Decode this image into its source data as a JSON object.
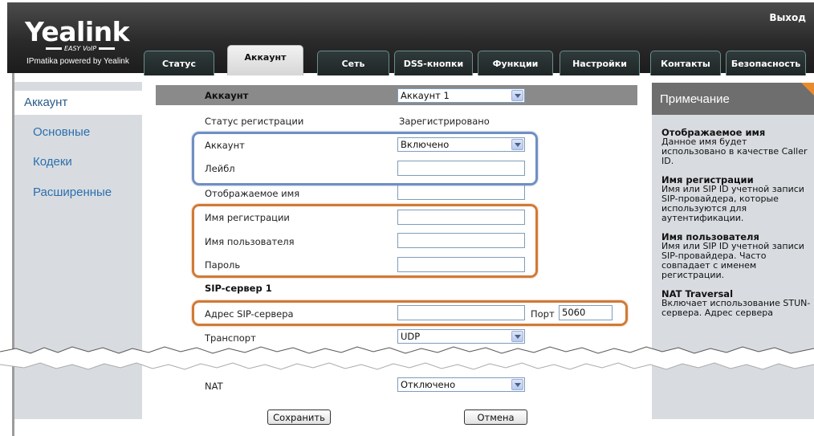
{
  "header": {
    "logo": "Yealink",
    "logo_sub": "EASY VoIP",
    "logo_tagline": "IPmatika powered by Yealink",
    "logout": "Выход",
    "tabs": [
      "Статус",
      "Аккаунт",
      "Сеть",
      "DSS-кнопки",
      "Функции",
      "Настройки",
      "Контакты",
      "Безопасность"
    ],
    "active_tab": "Аккаунт"
  },
  "sidebar": {
    "items": [
      "Аккаунт",
      "Основные",
      "Кодеки",
      "Расширенные"
    ],
    "active": "Аккаунт"
  },
  "form": {
    "account_label": "Аккаунт",
    "account_select": "Аккаунт 1",
    "reg_status_label": "Статус регистрации",
    "reg_status_value": "Зарегистрировано",
    "line_active_label": "Аккаунт",
    "line_active_value": "Включено",
    "label_label": "Лейбл",
    "label_value": "",
    "display_name_label": "Отображаемое имя",
    "display_name_value": "",
    "register_name_label": "Имя регистрации",
    "register_name_value": "",
    "user_name_label": "Имя пользователя",
    "user_name_value": "",
    "password_label": "Пароль",
    "password_value": "",
    "sip_server_heading": "SIP-сервер 1",
    "sip_address_label": "Адрес SIP-сервера",
    "sip_address_value": "",
    "port_label": "Порт",
    "port_value": "5060",
    "transport_label": "Транспорт",
    "transport_value": "UDP",
    "nat_label": "NAT",
    "nat_value": "Отключено",
    "save_button": "Сохранить",
    "cancel_button": "Отмена"
  },
  "note": {
    "title": "Примечание",
    "sections": [
      {
        "heading": "Отображаемое имя",
        "text": "Данное имя будет использовано в качестве Caller ID."
      },
      {
        "heading": "Имя регистрации",
        "text": "Имя или SIP ID учетной записи SIP-провайдера, которые используются для аутентификации."
      },
      {
        "heading": "Имя пользователя",
        "text": "Имя или SIP ID учетной записи SIP-провайдера. Часто совпадает с именем регистрации."
      },
      {
        "heading": "NAT Traversal",
        "text": "Включает использование STUN-сервера. Адрес сервера"
      }
    ]
  },
  "colors": {
    "highlight_blue": "#6f8fc3",
    "highlight_orange": "#d07a36",
    "nav_link": "#2c6fae",
    "note_accent": "#e88a2e"
  }
}
